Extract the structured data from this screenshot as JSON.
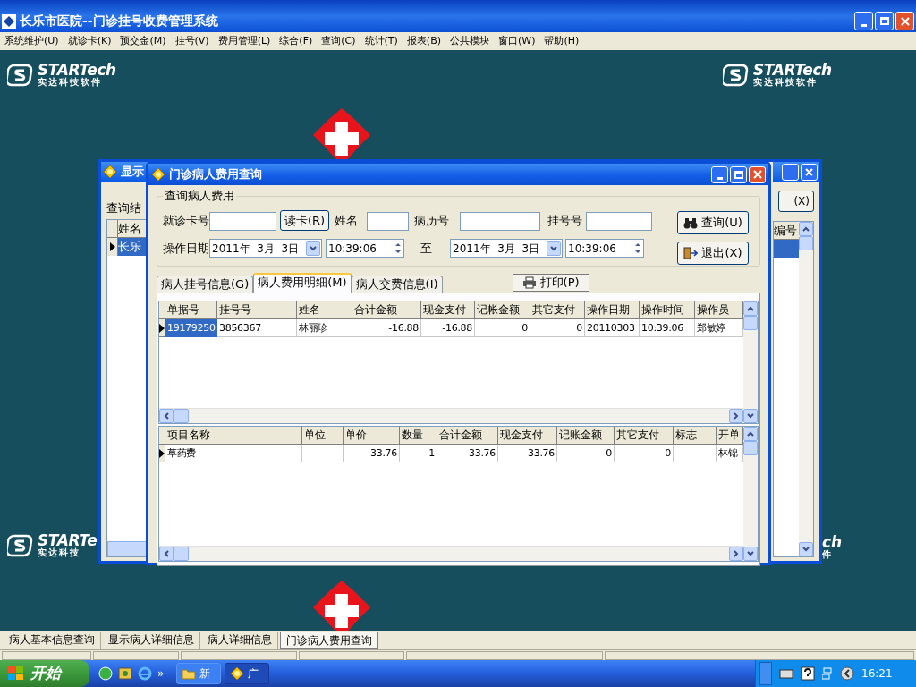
{
  "app": {
    "title": "长乐市医院--门诊挂号收费管理系统"
  },
  "menu": [
    "系统维护(U)",
    "就诊卡(K)",
    "预交金(M)",
    "挂号(V)",
    "费用管理(L)",
    "综合(F)",
    "查询(C)",
    "统计(T)",
    "报表(B)",
    "公共模块",
    "窗口(W)",
    "帮助(H)"
  ],
  "logos": [
    {
      "brand": "STARTech",
      "subtitle": "实达科技软件"
    },
    {
      "brand": "STARTech",
      "subtitle": "实达科技软件"
    },
    {
      "brand": "STARTe",
      "subtitle": "实达科技"
    }
  ],
  "logo_fragment": {
    "brand": "ch",
    "subtitle": "件"
  },
  "back_window": {
    "title": "显示",
    "label": "查询结",
    "column": "姓名",
    "cell": "长乐",
    "button": "(X)",
    "column_2": "编号"
  },
  "dialog": {
    "title": "门诊病人费用查询",
    "group": "查询病人费用",
    "row1": [
      {
        "kind": "label",
        "text": "就诊卡号"
      },
      {
        "kind": "input"
      },
      {
        "kind": "button",
        "text": "读卡(R)"
      },
      {
        "kind": "label",
        "text": "姓名"
      },
      {
        "kind": "input"
      },
      {
        "kind": "label",
        "text": "病历号"
      },
      {
        "kind": "input"
      },
      {
        "kind": "label",
        "text": "挂号号"
      },
      {
        "kind": "input"
      }
    ],
    "row2": [
      {
        "kind": "label",
        "text": "操作日期"
      },
      {
        "kind": "date",
        "value": "2011年  3月  3日"
      },
      {
        "kind": "time",
        "value": "10:39:06"
      },
      {
        "kind": "label",
        "text": "至"
      },
      {
        "kind": "date",
        "value": "2011年  3月  3日"
      },
      {
        "kind": "time",
        "value": "10:39:06"
      }
    ],
    "query_button": "查询(U)",
    "exit_button": "退出(X)",
    "tabs": [
      {
        "label": "病人挂号信息(G)",
        "selected": false
      },
      {
        "label": "病人费用明细(M)",
        "selected": true
      },
      {
        "label": "病人交费信息(I)",
        "selected": false
      }
    ],
    "print_button": "打印(P)",
    "grid1": {
      "columns": [
        "单据号",
        "挂号号",
        "姓名",
        "合计金额",
        "现金支付",
        "记帐金额",
        "其它支付",
        "操作日期",
        "操作时间",
        "操作员"
      ],
      "rows": [
        {
          "current": true,
          "cells": [
            {
              "text": "19179250",
              "selected": true
            },
            {
              "text": "3856367",
              "selected": false
            },
            {
              "text": "林丽珍",
              "selected": false
            },
            {
              "text": "-16.88",
              "selected": false
            },
            {
              "text": "-16.88",
              "selected": false
            },
            {
              "text": "0",
              "selected": false
            },
            {
              "text": "0",
              "selected": false
            },
            {
              "text": "20110303",
              "selected": false
            },
            {
              "text": "10:39:06",
              "selected": false
            },
            {
              "text": "郑敏婷",
              "selected": false
            }
          ]
        }
      ]
    },
    "grid2": {
      "columns": [
        "项目名称",
        "单位",
        "单价",
        "数量",
        "合计金额",
        "现金支付",
        "记账金额",
        "其它支付",
        "标志",
        "开单"
      ],
      "rows": [
        {
          "current": true,
          "cells": [
            {
              "text": "草药费",
              "selected": false
            },
            {
              "selected": false
            },
            {
              "text": "-33.76",
              "selected": false
            },
            {
              "text": "1",
              "selected": false
            },
            {
              "text": "-33.76",
              "selected": false
            },
            {
              "text": "-33.76",
              "selected": false
            },
            {
              "text": "0",
              "selected": false
            },
            {
              "text": "0",
              "selected": false
            },
            {
              "text": "-",
              "selected": false
            },
            {
              "text": "林锦",
              "selected": false
            }
          ]
        }
      ]
    }
  },
  "mdi_tabs": [
    {
      "label": "病人基本信息查询",
      "selected": false
    },
    {
      "label": "显示病人详细信息",
      "selected": false
    },
    {
      "label": "病人详细信息",
      "selected": false
    },
    {
      "label": "门诊病人费用查询",
      "selected": true
    }
  ],
  "taskbar": {
    "start": "开始",
    "more": "»",
    "tasks": [
      {
        "label": "新",
        "kind": "folder",
        "selected": false
      },
      {
        "label": "广",
        "kind": "app",
        "selected": true
      }
    ],
    "clock": "16:21"
  }
}
